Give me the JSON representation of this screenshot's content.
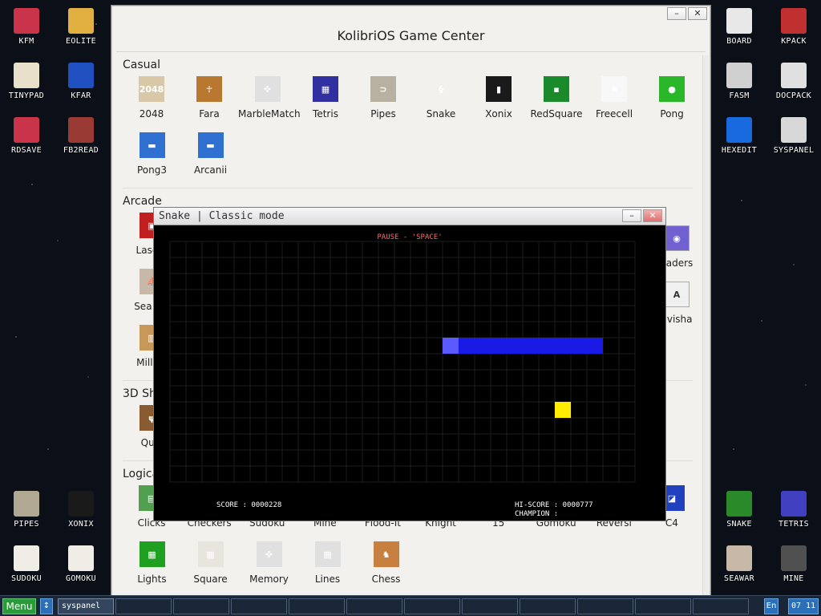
{
  "desktop": {
    "left_icons": [
      {
        "label": "KFM",
        "icon": "floppy-icon",
        "color": "#c9344a"
      },
      {
        "label": "EOLITE",
        "icon": "folder-icon",
        "color": "#e2b040"
      },
      {
        "label": "TINYPAD",
        "icon": "notepad-icon",
        "color": "#e8e0c8"
      },
      {
        "label": "KFAR",
        "icon": "commander-icon",
        "color": "#2050c0"
      },
      {
        "label": "RDSAVE",
        "icon": "save-icon",
        "color": "#c9344a"
      },
      {
        "label": "FB2READ",
        "icon": "book-icon",
        "color": "#9a3a34"
      },
      {
        "label": "PIPES",
        "icon": "pipes-icon",
        "color": "#b0a890"
      },
      {
        "label": "XONIX",
        "icon": "xonix-icon",
        "color": "#1a1a1a"
      },
      {
        "label": "SUDOKU",
        "icon": "sudoku-icon",
        "color": "#f0ece6"
      },
      {
        "label": "GOMOKU",
        "icon": "gomoku-icon",
        "color": "#f0ece6"
      }
    ],
    "right_icons": [
      {
        "label": "BOARD",
        "icon": "board-icon",
        "color": "#e8e8e8"
      },
      {
        "label": "KPACK",
        "icon": "kpack-icon",
        "color": "#c03030"
      },
      {
        "label": "FASM",
        "icon": "fasm-icon",
        "color": "#d0d0d0"
      },
      {
        "label": "DOCPACK",
        "icon": "docpack-icon",
        "color": "#e0e0e0"
      },
      {
        "label": "HEXEDIT",
        "icon": "hexedit-icon",
        "color": "#1a6adf"
      },
      {
        "label": "SYSPANEL",
        "icon": "syspanel-icon",
        "color": "#d8d8d8"
      },
      {
        "label": "SNAKE",
        "icon": "snake-icon",
        "color": "#2a8a2a"
      },
      {
        "label": "TETRIS",
        "icon": "tetris-icon",
        "color": "#4040c0"
      },
      {
        "label": "SEAWAR",
        "icon": "seawar-icon",
        "color": "#c8b8a8"
      },
      {
        "label": "MINE",
        "icon": "mine-icon",
        "color": "#505050"
      }
    ]
  },
  "game_center": {
    "title": "KolibriOS Game Center",
    "sections": [
      {
        "title": "Casual",
        "rows": [
          [
            {
              "label": "2048",
              "icon": "2048-icon",
              "color": "#d8c8a8",
              "glyph": "2048"
            },
            {
              "label": "Fara",
              "icon": "fara-icon",
              "color": "#b87830",
              "glyph": "☥"
            },
            {
              "label": "MarbleMatch",
              "icon": "gamepad-icon",
              "color": "#e0e0e0",
              "glyph": "✜"
            },
            {
              "label": "Tetris",
              "icon": "tetris-icon",
              "color": "#3030a0",
              "glyph": "▦"
            },
            {
              "label": "Pipes",
              "icon": "pipes-icon",
              "color": "#b8b0a0",
              "glyph": "⊃"
            },
            {
              "label": "Snake",
              "icon": "snake-icon",
              "color": "#f3f1ee",
              "glyph": "§"
            },
            {
              "label": "Xonix",
              "icon": "xonix-icon",
              "color": "#1a1a1a",
              "glyph": "▮"
            },
            {
              "label": "RedSquare",
              "icon": "redsquare-icon",
              "color": "#1a8a2a",
              "glyph": "▪"
            },
            {
              "label": "Freecell",
              "icon": "cards-icon",
              "color": "#f8f8f8",
              "glyph": "♠"
            },
            {
              "label": "Pong",
              "icon": "ball-icon",
              "color": "#2ab82a",
              "glyph": "●"
            }
          ],
          [
            {
              "label": "Pong3",
              "icon": "paddle-icon",
              "color": "#3070d0",
              "glyph": "▬"
            },
            {
              "label": "Arcanii",
              "icon": "paddle-icon",
              "color": "#3070d0",
              "glyph": "▬"
            }
          ]
        ]
      },
      {
        "title": "Arcade",
        "rows": [
          [
            {
              "label": "LaserT",
              "icon": "tank-icon",
              "color": "#c02020",
              "glyph": "▣"
            }
          ],
          [
            {
              "label": "Sea Wa",
              "icon": "ship-icon",
              "color": "#c8b8a8",
              "glyph": "⛵"
            }
          ],
          [
            {
              "label": "Million",
              "icon": "million-icon",
              "color": "#c89858",
              "glyph": "▥"
            }
          ]
        ]
      },
      {
        "title": "3D Sh",
        "rows": [
          [
            {
              "label": "Qual",
              "icon": "quake-icon",
              "color": "#8a5a30",
              "glyph": "ψ"
            }
          ]
        ]
      },
      {
        "title": "Logical",
        "rows": [
          [
            {
              "label": "Clicks",
              "icon": "clicks-icon",
              "color": "#50a050",
              "glyph": "▤"
            },
            {
              "label": "Checkers",
              "icon": "checkers-icon",
              "color": "#f3f1ee",
              "glyph": ""
            },
            {
              "label": "Sudoku",
              "icon": "sudoku-icon",
              "color": "#f3f1ee",
              "glyph": ""
            },
            {
              "label": "Mine",
              "icon": "mine-icon",
              "color": "#f3f1ee",
              "glyph": ""
            },
            {
              "label": "Flood-It",
              "icon": "flood-icon",
              "color": "#f3f1ee",
              "glyph": ""
            },
            {
              "label": "Knight",
              "icon": "knight-icon",
              "color": "#f3f1ee",
              "glyph": ""
            },
            {
              "label": "15",
              "icon": "fifteen-icon",
              "color": "#f3f1ee",
              "glyph": ""
            },
            {
              "label": "Gomoku",
              "icon": "gomoku-icon",
              "color": "#f3f1ee",
              "glyph": ""
            },
            {
              "label": "Reversi",
              "icon": "reversi-icon",
              "color": "#f3f1ee",
              "glyph": ""
            },
            {
              "label": "C4",
              "icon": "c4-icon",
              "color": "#2040c0",
              "glyph": "◪"
            }
          ],
          [
            {
              "label": "Lights",
              "icon": "lights-icon",
              "color": "#20a020",
              "glyph": "▦"
            },
            {
              "label": "Square",
              "icon": "sudoku-icon",
              "color": "#e8e4de",
              "glyph": "▦"
            },
            {
              "label": "Memory",
              "icon": "gamepad-icon",
              "color": "#e0e0e0",
              "glyph": "✜"
            },
            {
              "label": "Lines",
              "icon": "lines-icon",
              "color": "#e0e0e0",
              "glyph": "▦"
            },
            {
              "label": "Chess",
              "icon": "chess-icon",
              "color": "#c88040",
              "glyph": "♞"
            }
          ]
        ]
      }
    ],
    "arcade_right_labels": [
      {
        "label": "vaders",
        "icon": "ufo-icon",
        "color": "#7060d0",
        "glyph": "◉"
      },
      {
        "label": "avisha",
        "icon": "keyboard-icon",
        "color": "#f0f0f0",
        "glyph": "A"
      }
    ]
  },
  "snake": {
    "title": "Snake | Classic mode",
    "pause_text": "PAUSE - 'SPACE'",
    "score_text": "SCORE : 0000228",
    "hiscore_text": "HI-SCORE : 0000777",
    "champion_text": "CHAMPION :",
    "grid_color": "#1e1e1e",
    "snake_color": "#1a1ae6",
    "head_color": "#5a5aff",
    "food_color": "#ffee00",
    "snake_cells": [
      [
        17,
        6
      ],
      [
        18,
        6
      ],
      [
        19,
        6
      ],
      [
        20,
        6
      ],
      [
        21,
        6
      ],
      [
        22,
        6
      ],
      [
        23,
        6
      ],
      [
        24,
        6
      ],
      [
        25,
        6
      ],
      [
        26,
        6
      ]
    ],
    "food_cell": [
      24,
      10
    ]
  },
  "taskbar": {
    "menu_label": "Menu",
    "arrow_label": "↕",
    "tasks": [
      "syspanel",
      "",
      "",
      "",
      "",
      "",
      "",
      "",
      "",
      "",
      "",
      ""
    ],
    "lang_label": "En",
    "clock_text": "07 11"
  }
}
